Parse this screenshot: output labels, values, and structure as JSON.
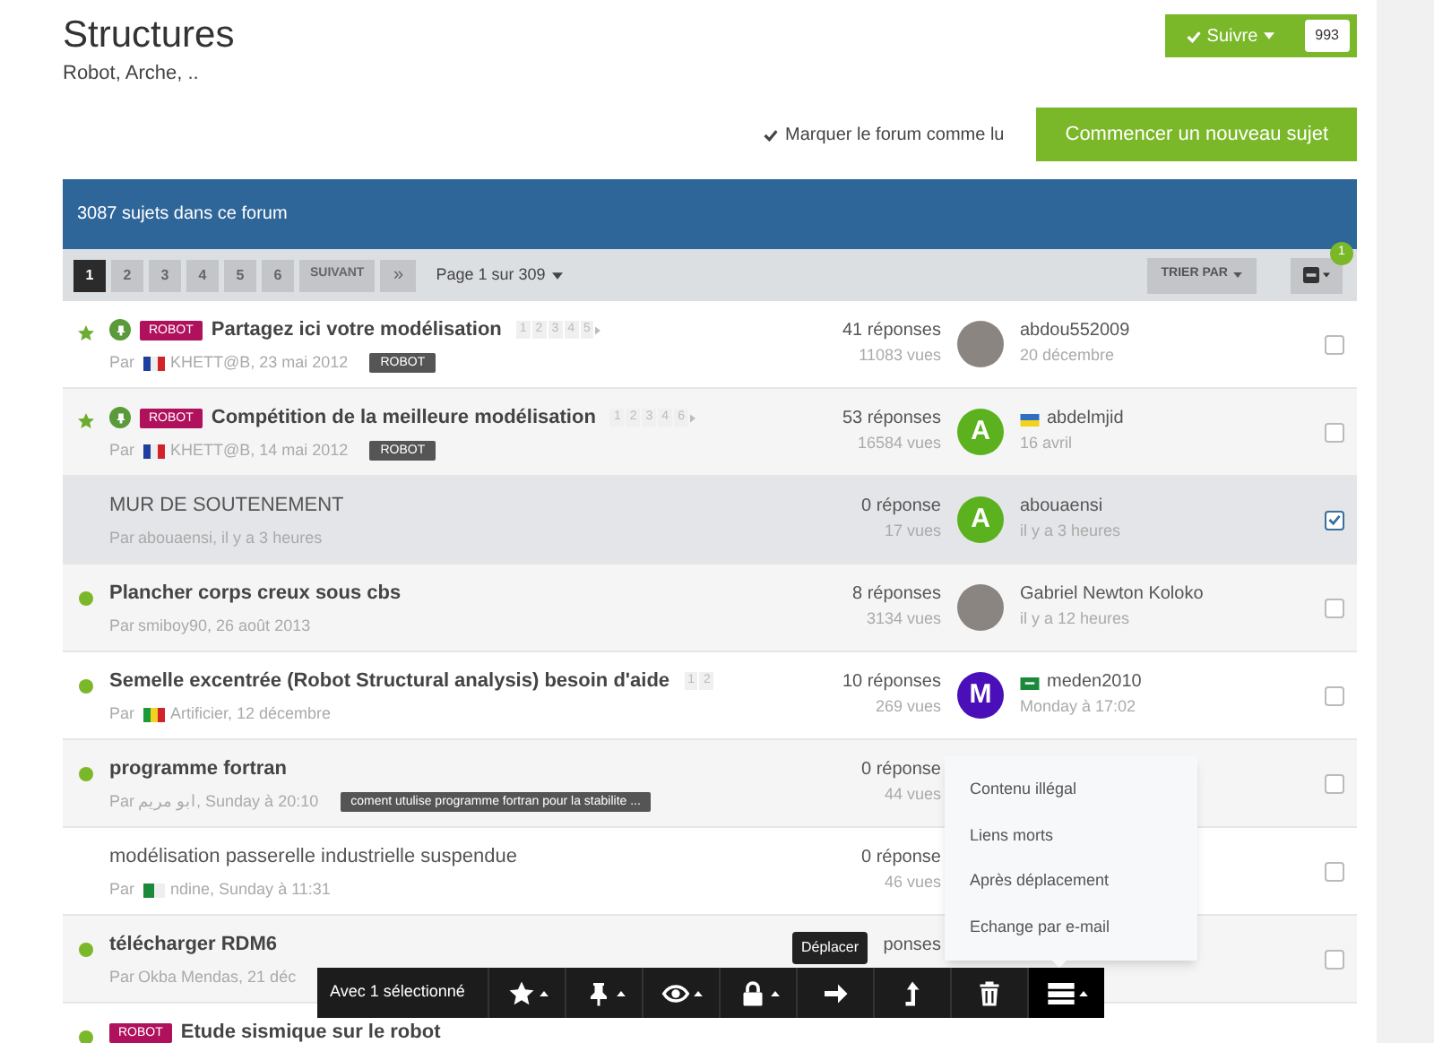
{
  "header": {
    "title": "Structures",
    "subtitle": "Robot, Arche, ..",
    "follow": {
      "label": "Suivre",
      "count": "993"
    }
  },
  "actions": {
    "mark_read": "Marquer le forum comme lu",
    "new_topic": "Commencer un nouveau sujet"
  },
  "banner": "3087 sujets dans ce forum",
  "pagination": {
    "pages": [
      {
        "label": "1",
        "selected": true
      },
      {
        "label": "2",
        "selected": false
      },
      {
        "label": "3",
        "selected": false
      },
      {
        "label": "4",
        "selected": false
      },
      {
        "label": "5",
        "selected": false
      },
      {
        "label": "6",
        "selected": false
      }
    ],
    "next": "SUIVANT",
    "last": "»",
    "page_info": "Page 1 sur 309",
    "sort": "TRIER PAR",
    "filter_badge": "1"
  },
  "topics": [
    {
      "title": "Partagez ici votre modélisation",
      "starred": true,
      "pinned": true,
      "unread": true,
      "prefix_tag": "ROBOT",
      "pages": [
        "1",
        "2",
        "3",
        "4",
        "5"
      ],
      "by": "Par",
      "flag": {
        "kind": "fr"
      },
      "meta": "KHETT@B, 23 mai 2012",
      "tag": "ROBOT",
      "replies": "41 réponses",
      "views": "11083 vues",
      "avatar": {
        "kind": "photo"
      },
      "last_poster": "abdou552009",
      "last_date": "20 décembre",
      "selected": false
    },
    {
      "title": "Compétition de la meilleure modélisation",
      "starred": true,
      "pinned": true,
      "unread": true,
      "prefix_tag": "ROBOT",
      "pages": [
        "1",
        "2",
        "3",
        "4",
        "6"
      ],
      "by": "Par",
      "flag": {
        "kind": "fr"
      },
      "meta": "KHETT@B, 14 mai 2012",
      "tag": "ROBOT",
      "replies": "53 réponses",
      "views": "16584 vues",
      "avatar": {
        "kind": "letter",
        "letter": "A",
        "color": "#5cb21e"
      },
      "last_flag": {
        "kind": "ua"
      },
      "last_poster": "abdelmjid",
      "last_date": "16 avril",
      "selected": false
    },
    {
      "title": "MUR DE SOUTENEMENT",
      "starred": false,
      "pinned": false,
      "unread": false,
      "by": "Par",
      "meta": "abouaensi, il y a 3 heures",
      "replies": "0 réponse",
      "views": "17 vues",
      "avatar": {
        "kind": "letter",
        "letter": "A",
        "color": "#5cb21e"
      },
      "last_poster": "abouaensi",
      "last_date": "il y a 3 heures",
      "selected": true
    },
    {
      "title": "Plancher corps creux sous cbs",
      "starred": false,
      "pinned": false,
      "unread": true,
      "by": "Par",
      "meta": "smiboy90, 26 août 2013",
      "replies": "8 réponses",
      "views": "3134 vues",
      "avatar": {
        "kind": "photo"
      },
      "last_poster": "Gabriel Newton Koloko",
      "last_date": "il y a 12 heures",
      "selected": false
    },
    {
      "title": "Semelle excentrée (Robot Structural analysis) besoin d'aide",
      "starred": false,
      "pinned": false,
      "unread": true,
      "pages": [
        "1",
        "2"
      ],
      "by": "Par",
      "flag": {
        "kind": "sn"
      },
      "meta": "Artificier, 12 décembre",
      "replies": "10 réponses",
      "views": "269 vues",
      "avatar": {
        "kind": "letter",
        "letter": "M",
        "color": "#4a0fb8"
      },
      "last_flag": {
        "kind": "sa"
      },
      "last_poster": "meden2010",
      "last_date": "Monday à 17:02",
      "selected": false
    },
    {
      "title": "programme fortran",
      "starred": false,
      "pinned": false,
      "unread": true,
      "by": "Par",
      "meta": "ابو مريم, Sunday à 20:10",
      "tag": "coment utulise programme fortran pour la stabilite ...",
      "replies": "0 réponse",
      "views": "44 vues",
      "selected": false
    },
    {
      "title": "modélisation passerelle industrielle suspendue",
      "starred": false,
      "pinned": false,
      "unread": false,
      "by": "Par",
      "flag": {
        "kind": "dz"
      },
      "meta": "ndine, Sunday à 11:31",
      "replies": "0 réponse",
      "views": "46 vues",
      "selected": false
    },
    {
      "title": "télécharger RDM6",
      "starred": false,
      "pinned": false,
      "unread": true,
      "by": "Par",
      "meta": "Okba Mendas, 21 déc",
      "replies": "ponses",
      "selected": false
    },
    {
      "title": "Etude sismique sur le robot",
      "starred": false,
      "pinned": false,
      "unread": true,
      "prefix_tag": "ROBOT"
    }
  ],
  "toolbar": {
    "label": "Avec 1 sélectionné",
    "buttons": [
      {
        "kind": "star",
        "caret": true,
        "selected": false
      },
      {
        "kind": "pin",
        "caret": true,
        "selected": false
      },
      {
        "kind": "eye",
        "caret": true,
        "selected": false
      },
      {
        "kind": "lock",
        "caret": true,
        "selected": false
      },
      {
        "kind": "move",
        "caret": false,
        "selected": false
      },
      {
        "kind": "merge",
        "caret": false,
        "selected": false
      },
      {
        "kind": "trash",
        "caret": false,
        "selected": false
      },
      {
        "kind": "menu",
        "caret": true,
        "selected": true
      }
    ]
  },
  "tooltip": "Déplacer",
  "menu": [
    "Contenu illégal",
    "Liens morts",
    "Après déplacement",
    "Echange par e-mail"
  ]
}
